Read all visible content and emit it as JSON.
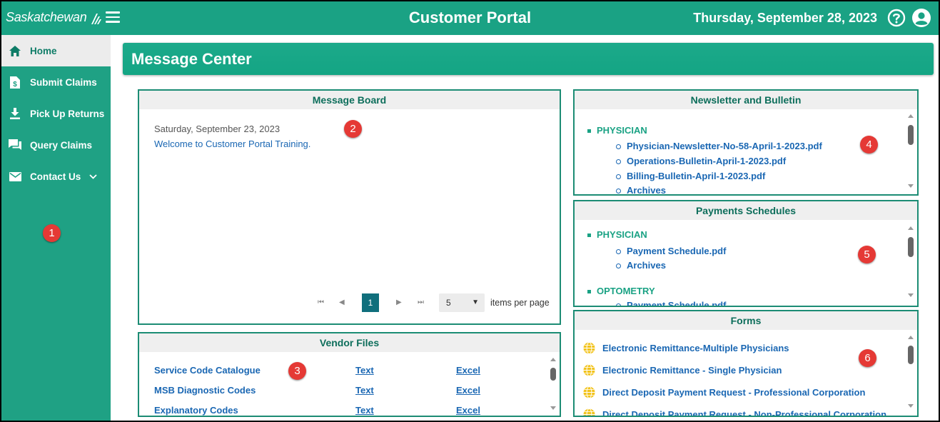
{
  "topbar": {
    "brand": "Saskatchewan",
    "title": "Customer Portal",
    "date": "Thursday, September 28, 2023"
  },
  "sidebar": {
    "items": [
      {
        "label": "Home",
        "icon": "home-icon",
        "active": true
      },
      {
        "label": "Submit Claims",
        "icon": "dollar-document-icon"
      },
      {
        "label": "Pick Up Returns",
        "icon": "download-icon"
      },
      {
        "label": "Query Claims",
        "icon": "chat-icon"
      },
      {
        "label": "Contact Us",
        "icon": "envelope-icon",
        "has_dropdown": true
      }
    ]
  },
  "message_center": {
    "title": "Message Center"
  },
  "message_board": {
    "title": "Message Board",
    "date": "Saturday, September 23, 2023",
    "message": "Welcome to Customer Portal Training.",
    "pager": {
      "current_page": "1",
      "page_size": "5",
      "items_label": "items per page"
    }
  },
  "vendor_files": {
    "title": "Vendor Files",
    "rows": [
      {
        "name": "Service Code Catalogue",
        "text": "Text",
        "excel": "Excel"
      },
      {
        "name": "MSB Diagnostic Codes",
        "text": "Text",
        "excel": "Excel"
      },
      {
        "name": "Explanatory Codes",
        "text": "Text",
        "excel": "Excel"
      }
    ]
  },
  "newsletter": {
    "title": "Newsletter and Bulletin",
    "category": "PHYSICIAN",
    "items": [
      "Physician-Newsletter-No-58-April-1-2023.pdf",
      "Operations-Bulletin-April-1-2023.pdf",
      "Billing-Bulletin-April-1-2023.pdf",
      "Archives"
    ]
  },
  "payments": {
    "title": "Payments Schedules",
    "categories": [
      {
        "name": "PHYSICIAN",
        "items": [
          "Payment Schedule.pdf",
          "Archives"
        ]
      },
      {
        "name": "OPTOMETRY",
        "items": [
          "Payment Schedule.pdf"
        ]
      }
    ]
  },
  "forms": {
    "title": "Forms",
    "items": [
      "Electronic Remittance-Multiple Physicians",
      "Electronic Remittance - Single Physician",
      "Direct Deposit Payment Request - Professional Corporation",
      "Direct Deposit Payment Request - Non-Professional Corporation"
    ]
  },
  "callouts": [
    "1",
    "2",
    "3",
    "4",
    "5",
    "6"
  ],
  "colors": {
    "brand_green": "#1aa284",
    "link_blue": "#1a67b3",
    "panel_border": "#1c8c74",
    "callout_red": "#e53935",
    "pager_active": "#106f7c"
  }
}
